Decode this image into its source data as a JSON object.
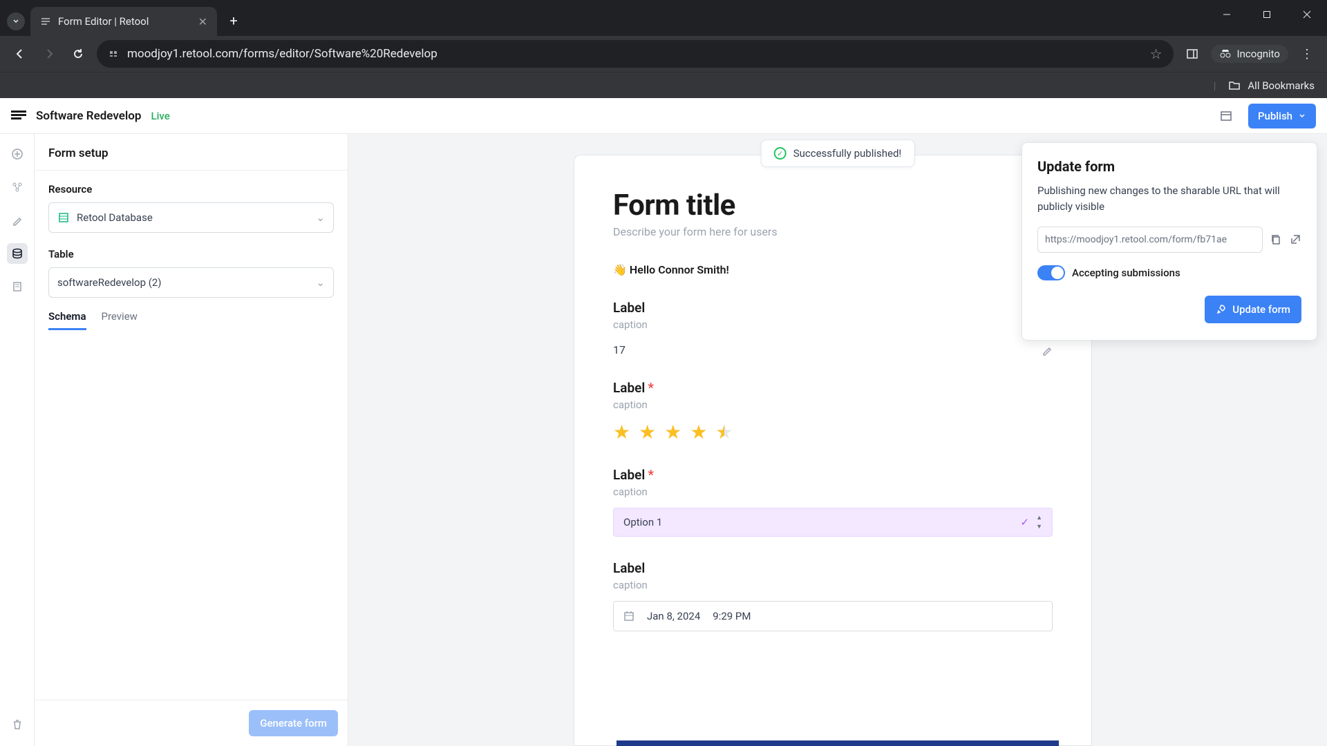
{
  "browser": {
    "tab_title": "Form Editor | Retool",
    "url": "moodjoy1.retool.com/forms/editor/Software%20Redevelop",
    "incognito_label": "Incognito",
    "all_bookmarks": "All Bookmarks"
  },
  "app": {
    "logo_name": "retool-logo",
    "title": "Software Redevelop",
    "status": "Live",
    "publish_label": "Publish"
  },
  "toast": {
    "text": "Successfully published!"
  },
  "sidebar": {
    "title": "Form setup",
    "resource_label": "Resource",
    "resource_value": "Retool Database",
    "table_label": "Table",
    "table_value": "softwareRedevelop (2)",
    "tabs": {
      "schema": "Schema",
      "preview": "Preview"
    },
    "generate_label": "Generate form"
  },
  "form": {
    "title": "Form title",
    "description": "Describe your form here for users",
    "greeting_emoji": "👋",
    "greeting": "Hello Connor Smith!",
    "label_text": "Label",
    "caption_text": "caption",
    "field1_value": "17",
    "rating_value": 4.5,
    "option_value": "Option 1",
    "date_value": "Jan 8, 2024",
    "time_value": "9:29 PM"
  },
  "popover": {
    "title": "Update form",
    "description": "Publishing new changes to the sharable URL that will publicly visible",
    "url": "https://moodjoy1.retool.com/form/fb71ae",
    "toggle_label": "Accepting submissions",
    "button_label": "Update form"
  }
}
